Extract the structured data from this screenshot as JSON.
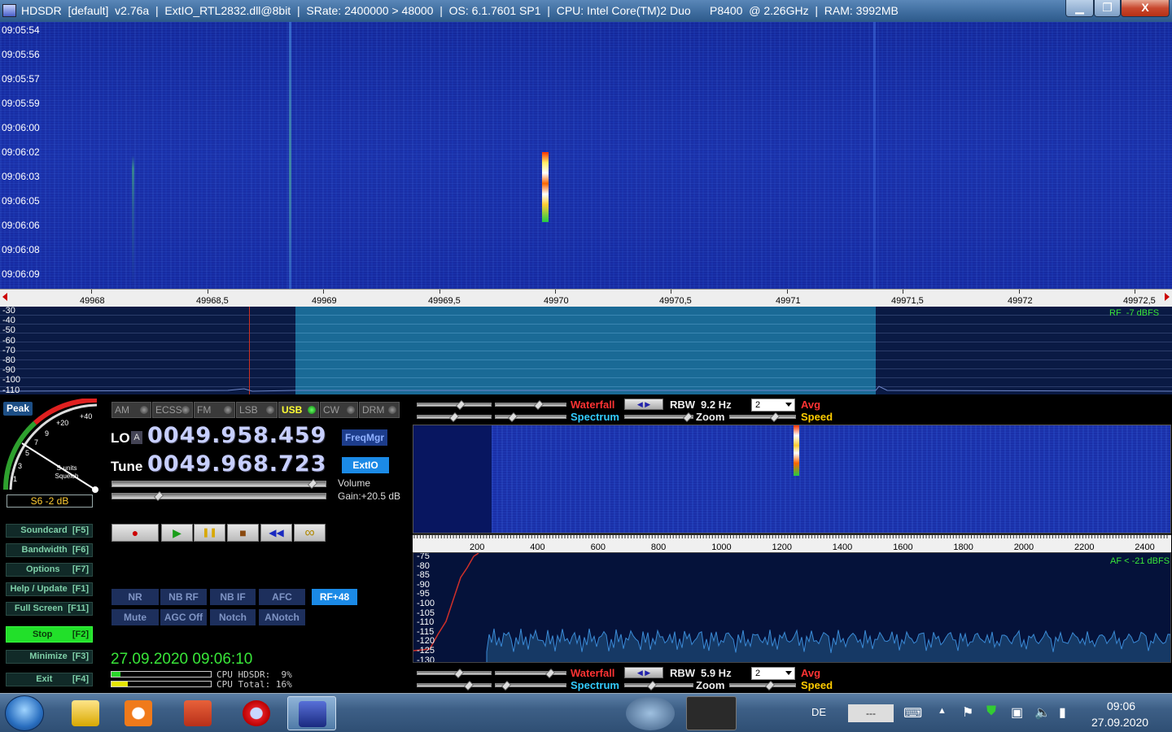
{
  "window": {
    "title": "HDSDR  [default]  v2.76a  |  ExtIO_RTL2832.dll@8bit  |  SRate: 2400000 > 48000  |  OS: 6.1.7601 SP1  |  CPU: Intel Core(TM)2 Duo      P8400  @ 2.26GHz  |  RAM: 3992MB",
    "min_label": "▁",
    "max_label": "❐",
    "close_label": "X"
  },
  "waterfall": {
    "timestamps": [
      "09:05:54",
      "09:05:56",
      "09:05:57",
      "09:05:59",
      "09:06:00",
      "09:06:02",
      "09:06:03",
      "09:06:05",
      "09:06:06",
      "09:06:08",
      "09:06:09"
    ]
  },
  "freq_scale": {
    "labels": [
      "49968",
      "49968,5",
      "49969",
      "49969,5",
      "49970",
      "49970,5",
      "49971",
      "49971,5",
      "49972",
      "49972,5"
    ]
  },
  "rf_spectrum": {
    "y_labels": [
      "-30",
      "-40",
      "-50",
      "-60",
      "-70",
      "-80",
      "-90",
      "-100",
      "-110"
    ],
    "rf_level": "RF  -7 dBFS"
  },
  "smeter": {
    "peak_label": "Peak",
    "scale": [
      "+40",
      "+20",
      "9",
      "7",
      "5",
      "3",
      "1"
    ],
    "caption": "S-units\nSquelch",
    "reading": "S6 -2 dB"
  },
  "left_buttons": [
    {
      "label": "Soundcard  [F5]"
    },
    {
      "label": "Bandwidth  [F6]"
    },
    {
      "label": "Options     [F7]"
    },
    {
      "label": "Help / Update  [F1]"
    },
    {
      "label": "Full Screen  [F11]"
    },
    {
      "label": "Stop        [F2]"
    },
    {
      "label": "Minimize  [F3]"
    },
    {
      "label": "Exit        [F4]"
    }
  ],
  "modes": [
    {
      "label": "AM",
      "active": false
    },
    {
      "label": "ECSS",
      "active": false
    },
    {
      "label": "FM",
      "active": false
    },
    {
      "label": "LSB",
      "active": false
    },
    {
      "label": "USB",
      "active": true
    },
    {
      "label": "CW",
      "active": false
    },
    {
      "label": "DRM",
      "active": false
    }
  ],
  "frequency": {
    "lo_label": "LO",
    "lo_suffix": "A",
    "lo_value": "0049.958.459",
    "tune_label": "Tune",
    "tune_value": "0049.968.723",
    "freqmgr_label": "FreqMgr",
    "extio_label": "ExtIO"
  },
  "volume": {
    "label": "Volume",
    "gain": "Gain:+20.5 dB"
  },
  "transport": [
    "●",
    "▶",
    "❚❚",
    "■",
    "◀◀",
    "∞"
  ],
  "dsp": {
    "row1": [
      "NR",
      "NB RF",
      "NB IF",
      "AFC"
    ],
    "rf_btn": "RF+48",
    "row2": [
      "Mute",
      "AGC Off",
      "Notch",
      "ANotch"
    ]
  },
  "status": {
    "clock": "27.09.2020 09:06:10",
    "cpu_hdsdr": "CPU HDSDR:  9%",
    "cpu_total": "CPU Total: 16%",
    "cpu_hdsdr_value": 0.09,
    "cpu_total_value": 0.16
  },
  "audio_controls_top": {
    "waterfall_label": "Waterfall",
    "spectrum_label": "Spectrum",
    "rbw_label": "RBW",
    "rbw_value": "9.2 Hz",
    "zoom_label": "Zoom",
    "dropdown_value": "2",
    "avg_label": "Avg",
    "speed_label": "Speed"
  },
  "audio_controls_bottom": {
    "waterfall_label": "Waterfall",
    "spectrum_label": "Spectrum",
    "rbw_label": "RBW",
    "rbw_value": "5.9 Hz",
    "zoom_label": "Zoom",
    "dropdown_value": "2",
    "avg_label": "Avg",
    "speed_label": "Speed"
  },
  "af_scale": {
    "labels": [
      "200",
      "400",
      "600",
      "800",
      "1000",
      "1200",
      "1400",
      "1600",
      "1800",
      "2000",
      "2200",
      "2400"
    ]
  },
  "af_spectrum": {
    "y_labels": [
      "-75",
      "-80",
      "-85",
      "-90",
      "-95",
      "-100",
      "-105",
      "-110",
      "-115",
      "-120",
      "-125",
      "-130"
    ],
    "af_level": "AF < -21 dBFS"
  },
  "taskbar": {
    "lang": "DE",
    "box_text": "---",
    "time": "09:06",
    "date": "27.09.2020"
  },
  "colors": {
    "waterfall_bg": "#1a30a8",
    "rf_passband": "#1a6a96",
    "green_text": "#39e639",
    "stop_button": "#22e02a",
    "freq_digits": "#c7cfff"
  }
}
